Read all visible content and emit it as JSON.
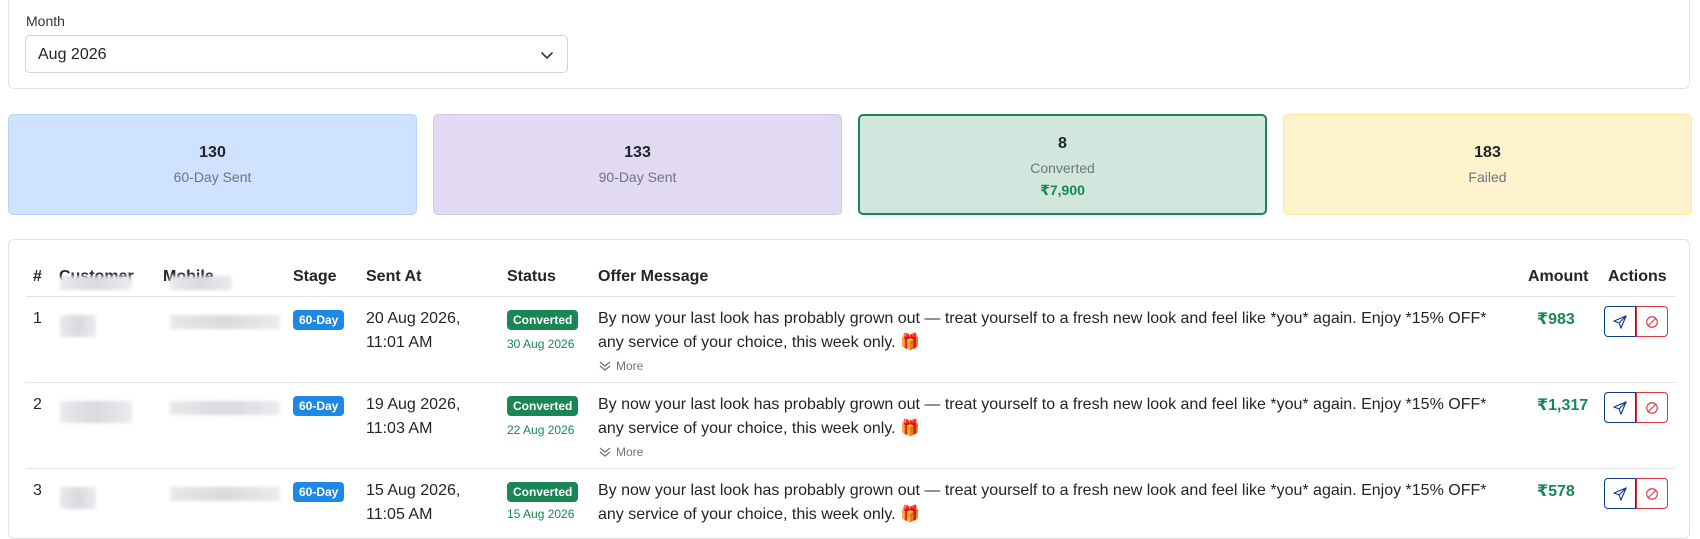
{
  "filter": {
    "label": "Month",
    "selected": "Aug 2026"
  },
  "stats": [
    {
      "value": "130",
      "label": "60-Day Sent"
    },
    {
      "value": "133",
      "label": "90-Day Sent"
    },
    {
      "value": "8",
      "label": "Converted",
      "amount": "₹7,900"
    },
    {
      "value": "183",
      "label": "Failed"
    }
  ],
  "table": {
    "headers": [
      "#",
      "Customer",
      "Mobile",
      "Stage",
      "Sent At",
      "Status",
      "Offer Message",
      "Amount",
      "Actions"
    ],
    "more_label": "More",
    "rows": [
      {
        "num": "1",
        "stage": "60-Day",
        "sent_at_1": "20 Aug 2026,",
        "sent_at_2": "11:01 AM",
        "status": "Converted",
        "status_date": "30 Aug 2026",
        "message_1": "By now your last look has probably grown out — treat yourself to a fresh new look and feel like *you* again. Enjoy *15% OFF*",
        "message_2": "any service of your choice, this week only. 🎁",
        "amount": "₹983"
      },
      {
        "num": "2",
        "stage": "60-Day",
        "sent_at_1": "19 Aug 2026,",
        "sent_at_2": "11:03 AM",
        "status": "Converted",
        "status_date": "22 Aug 2026",
        "message_1": "By now your last look has probably grown out — treat yourself to a fresh new look and feel like *you* again. Enjoy *15% OFF*",
        "message_2": "any service of your choice, this week only. 🎁",
        "amount": "₹1,317"
      },
      {
        "num": "3",
        "stage": "60-Day",
        "sent_at_1": "15 Aug 2026,",
        "sent_at_2": "11:05 AM",
        "status": "Converted",
        "status_date": "15 Aug 2026",
        "message_1": "By now your last look has probably grown out — treat yourself to a fresh new look and feel like *you* again. Enjoy *15% OFF*",
        "message_2": "any service of your choice, this week only. 🎁",
        "amount": "₹578"
      }
    ]
  },
  "colors": {
    "success": "#198754",
    "stage_badge": "#1e88e5",
    "primary_outline": "#0d3b8c",
    "danger": "#dc3545"
  }
}
